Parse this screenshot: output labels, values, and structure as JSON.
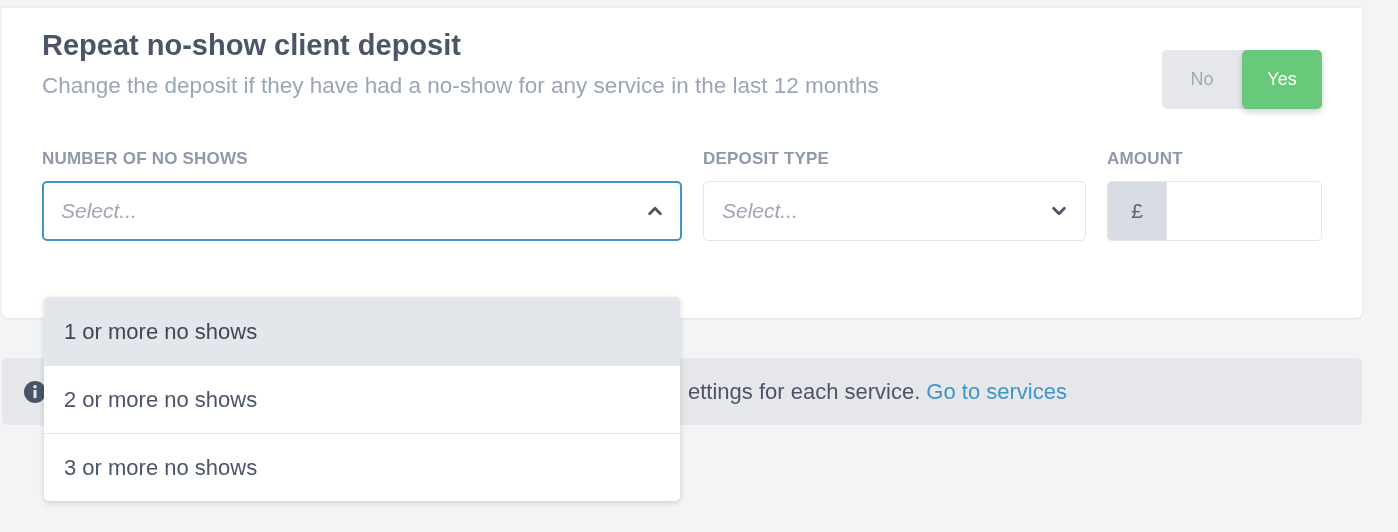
{
  "section": {
    "title": "Repeat no-show client deposit",
    "description": "Change the deposit if they have had a no-show for any service in the last 12 months",
    "toggle": [
      {
        "label": "No",
        "selected": false
      },
      {
        "label": "Yes",
        "selected": true
      }
    ],
    "fields": [
      {
        "kind": "select",
        "label": "NUMBER OF NO SHOWS",
        "placeholder": "Select...",
        "expanded": true
      },
      {
        "kind": "select",
        "label": "DEPOSIT TYPE",
        "placeholder": "Select...",
        "expanded": false
      },
      {
        "kind": "amount",
        "label": "AMOUNT",
        "prefix": "£"
      }
    ]
  },
  "dropdown": {
    "options": [
      {
        "label": "1 or more no shows",
        "selected": true
      },
      {
        "label": "2 or more no shows",
        "selected": false
      },
      {
        "label": "3 or more no shows",
        "selected": false
      }
    ]
  },
  "info": {
    "text": "ettings for each service.",
    "link": "Go to services"
  }
}
